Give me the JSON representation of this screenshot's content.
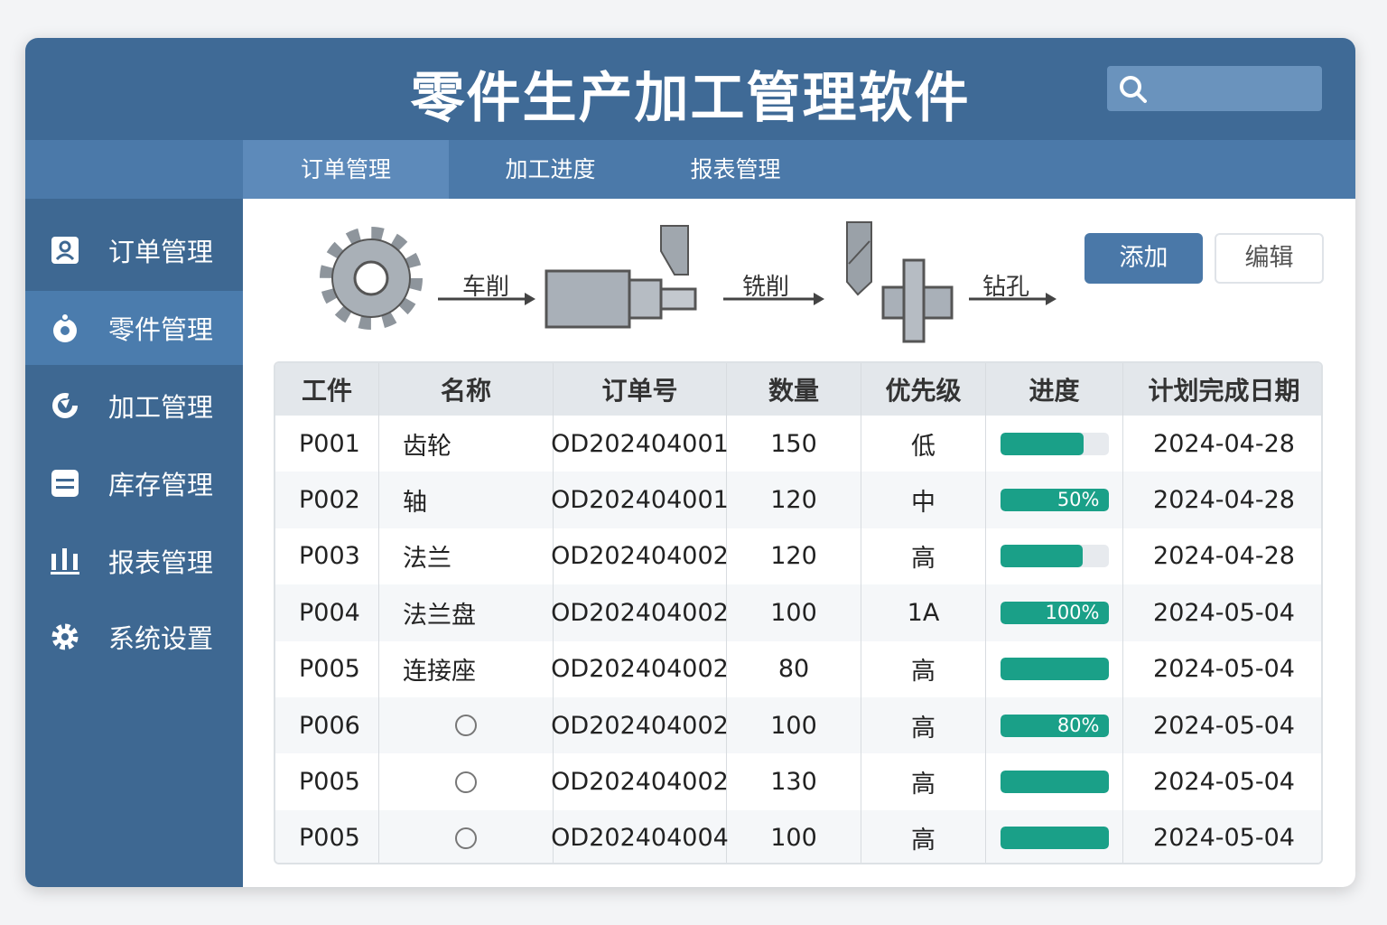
{
  "app": {
    "title": "零件生产加工管理软件"
  },
  "tabs": [
    {
      "label": "订单管理",
      "active": true
    },
    {
      "label": "加工进度",
      "active": false
    },
    {
      "label": "报表管理",
      "active": false
    }
  ],
  "sidebar": {
    "items": [
      {
        "label": "订单管理",
        "icon": "user-card-icon",
        "active": false
      },
      {
        "label": "零件管理",
        "icon": "part-icon",
        "active": true
      },
      {
        "label": "加工管理",
        "icon": "process-cycle-icon",
        "active": false
      },
      {
        "label": "库存管理",
        "icon": "inventory-icon",
        "active": false
      },
      {
        "label": "报表管理",
        "icon": "bar-chart-icon",
        "active": false
      },
      {
        "label": "系统设置",
        "icon": "gear-icon",
        "active": false
      }
    ]
  },
  "process": {
    "steps": [
      "车削",
      "铣削",
      "钻孔"
    ]
  },
  "toolbar": {
    "add_label": "添加",
    "edit_label": "编辑"
  },
  "table": {
    "headers": [
      "工件",
      "名称",
      "订单号",
      "数量",
      "优先级",
      "进度",
      "计划完成日期"
    ],
    "rows": [
      {
        "id": "P001",
        "name": "齿轮",
        "order": "OD202404001",
        "qty": "150",
        "priority": "低",
        "progress": 0.77,
        "progress_label": "",
        "date": "2024-04-28"
      },
      {
        "id": "P002",
        "name": "轴",
        "order": "OD202404001",
        "qty": "120",
        "priority": "中",
        "progress": 1.0,
        "progress_label": "50%",
        "date": "2024-04-28"
      },
      {
        "id": "P003",
        "name": "法兰",
        "order": "OD202404002",
        "qty": "120",
        "priority": "高",
        "progress": 0.76,
        "progress_label": "",
        "date": "2024-04-28"
      },
      {
        "id": "P004",
        "name": "法兰盘",
        "order": "OD202404002",
        "qty": "100",
        "priority": "1A",
        "progress": 1.0,
        "progress_label": "100%",
        "date": "2024-05-04"
      },
      {
        "id": "P005",
        "name": "连接座",
        "order": "OD202404002",
        "qty": "80",
        "priority": "高",
        "progress": 1.0,
        "progress_label": "",
        "date": "2024-05-04"
      },
      {
        "id": "P006",
        "name": "",
        "order": "OD202404002",
        "qty": "100",
        "priority": "高",
        "progress": 1.0,
        "progress_label": "80%",
        "date": "2024-05-04"
      },
      {
        "id": "P005",
        "name": "",
        "order": "OD202404002",
        "qty": "130",
        "priority": "高",
        "progress": 1.0,
        "progress_label": "",
        "date": "2024-05-04"
      },
      {
        "id": "P005",
        "name": "",
        "order": "OD202404004",
        "qty": "100",
        "priority": "高",
        "progress": 1.0,
        "progress_label": "",
        "date": "2024-05-04"
      }
    ]
  },
  "colors": {
    "header": "#3f6a96",
    "accent": "#4a78a8",
    "progress": "#1aa088"
  }
}
